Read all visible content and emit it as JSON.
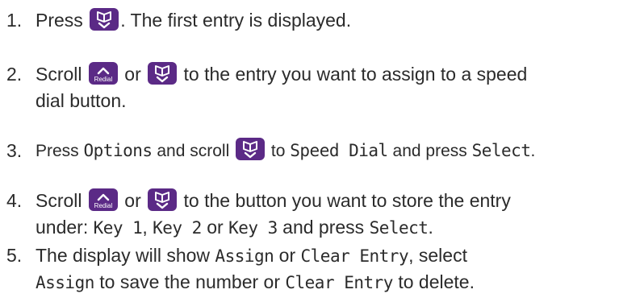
{
  "steps": [
    {
      "number": "1.",
      "lines": [
        {
          "t1": "Press ",
          "t2": ". The first entry is displayed."
        }
      ]
    },
    {
      "number": "2.",
      "lines": [
        {
          "t1": "Scroll ",
          "t2": " or ",
          "t3": " to the entry you want to assign to a speed"
        },
        {
          "t1": "dial button."
        }
      ]
    },
    {
      "number": "3.",
      "lines": [
        {
          "t1": "Press ",
          "lcd1": "Options",
          "t2": " and scroll ",
          "t3": " to ",
          "lcd2": "Speed Dial",
          "t4": " and press ",
          "lcd3": "Select",
          "t5": "."
        }
      ]
    },
    {
      "number": "4.",
      "lines": [
        {
          "t1": "Scroll ",
          "t2": " or ",
          "t3": " to the button you want to store the entry"
        },
        {
          "t1": "under: ",
          "lcd1": "Key 1",
          "t2": ", ",
          "lcd2": "Key 2",
          "t3": " or ",
          "lcd3": "Key 3",
          "t4": " and press ",
          "lcd4": "Select",
          "t5": "."
        }
      ]
    },
    {
      "number": "5.",
      "lines": [
        {
          "t1": "The display will show ",
          "lcd1": "Assign",
          "t2": " or ",
          "lcd2": "Clear Entry",
          "t3": ", select"
        },
        {
          "lcd1": "Assign",
          "t1": " to save the number or ",
          "lcd2": "Clear Entry",
          "t2": " to delete."
        }
      ]
    }
  ],
  "keys": {
    "redial_label": "Redial",
    "phonebook_icon": "phonebook-down-icon",
    "redial_icon": "redial-up-icon",
    "key_color": "#5b2a86"
  }
}
